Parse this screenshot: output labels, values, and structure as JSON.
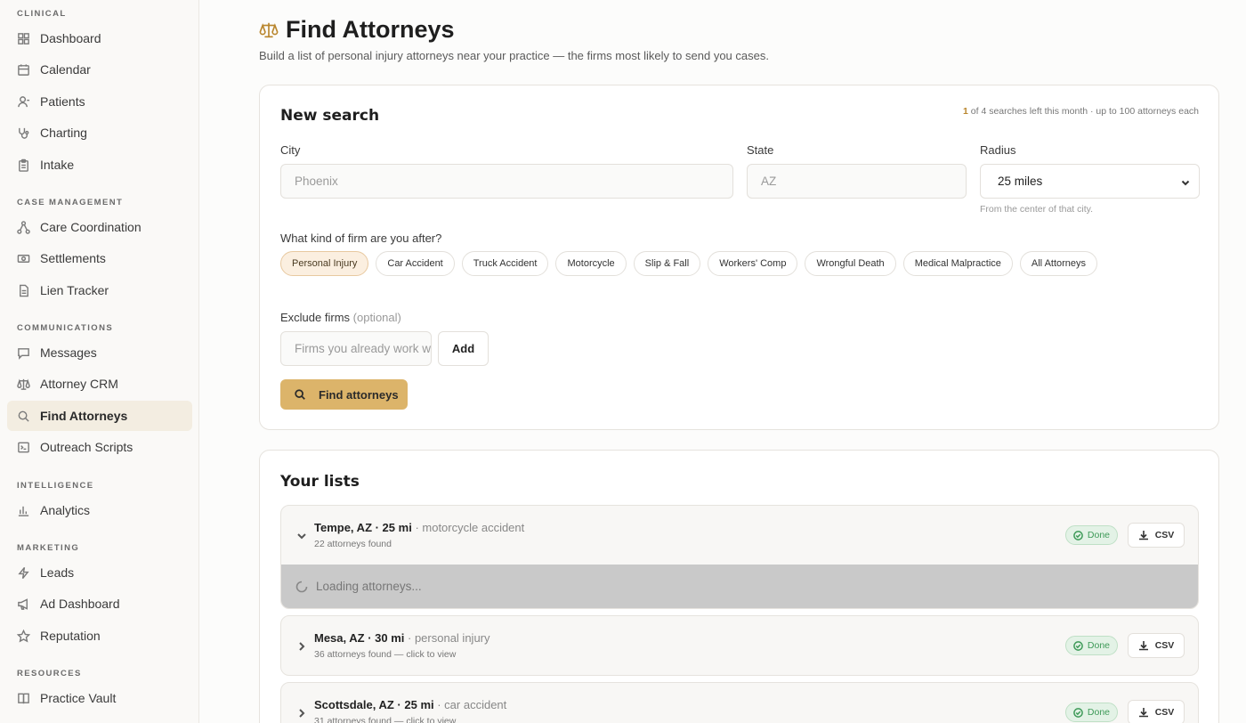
{
  "sidebar": {
    "sections": [
      {
        "label": "Clinical",
        "items": [
          {
            "label": "Dashboard",
            "icon": "grid-icon"
          },
          {
            "label": "Calendar",
            "icon": "calendar-icon"
          },
          {
            "label": "Patients",
            "icon": "user-icon"
          },
          {
            "label": "Charting",
            "icon": "stethoscope-icon"
          },
          {
            "label": "Intake",
            "icon": "clipboard-icon"
          }
        ]
      },
      {
        "label": "Case Management",
        "items": [
          {
            "label": "Care Coordination",
            "icon": "network-icon"
          },
          {
            "label": "Settlements",
            "icon": "money-icon"
          },
          {
            "label": "Lien Tracker",
            "icon": "document-icon"
          }
        ]
      },
      {
        "label": "Communications",
        "items": [
          {
            "label": "Messages",
            "icon": "message-icon"
          },
          {
            "label": "Attorney CRM",
            "icon": "scales-icon"
          },
          {
            "label": "Find Attorneys",
            "icon": "search-icon",
            "active": true
          },
          {
            "label": "Outreach Scripts",
            "icon": "script-icon"
          }
        ]
      },
      {
        "label": "Intelligence",
        "items": [
          {
            "label": "Analytics",
            "icon": "bar-chart-icon"
          }
        ]
      },
      {
        "label": "Marketing",
        "items": [
          {
            "label": "Leads",
            "icon": "lightning-icon"
          },
          {
            "label": "Ad Dashboard",
            "icon": "megaphone-icon"
          },
          {
            "label": "Reputation",
            "icon": "star-icon"
          }
        ]
      },
      {
        "label": "Resources",
        "items": [
          {
            "label": "Practice Vault",
            "icon": "book-icon"
          }
        ]
      }
    ]
  },
  "header": {
    "title": "Find Attorneys",
    "subtitle": "Build a list of personal injury attorneys near your practice — the firms most likely to send you cases.",
    "icon": "scales-icon"
  },
  "search": {
    "title": "New search",
    "quota_count": "1",
    "quota_text": "of 4 searches left this month · up to 100 attorneys each",
    "city_label": "City",
    "city_placeholder": "Phoenix",
    "state_label": "State",
    "state_placeholder": "AZ",
    "radius_label": "Radius",
    "radius_value": "25 miles",
    "radius_hint": "From the center of that city.",
    "firm_kind_label": "What kind of firm are you after?",
    "firm_kinds": [
      {
        "label": "Personal Injury",
        "selected": true
      },
      {
        "label": "Car Accident"
      },
      {
        "label": "Truck Accident"
      },
      {
        "label": "Motorcycle"
      },
      {
        "label": "Slip & Fall"
      },
      {
        "label": "Workers' Comp"
      },
      {
        "label": "Wrongful Death"
      },
      {
        "label": "Medical Malpractice"
      },
      {
        "label": "All Attorneys"
      }
    ],
    "exclude_label": "Exclude firms",
    "exclude_optional": "(optional)",
    "exclude_placeholder": "Firms you already work with",
    "add_label": "Add",
    "find_label": "Find attorneys"
  },
  "lists": {
    "title": "Your lists",
    "items": [
      {
        "place": "Tempe, AZ · 25 mi",
        "kind": "· motorcycle accident",
        "count": "22 attorneys found",
        "status": "Done",
        "csv": "CSV",
        "expanded": true,
        "loading_text": "Loading attorneys..."
      },
      {
        "place": "Mesa, AZ · 30 mi",
        "kind": "· personal injury",
        "count": "36 attorneys found — click to view",
        "status": "Done",
        "csv": "CSV"
      },
      {
        "place": "Scottsdale, AZ · 25 mi",
        "kind": "· car accident",
        "count": "31 attorneys found — click to view",
        "status": "Done",
        "csv": "CSV"
      }
    ]
  }
}
